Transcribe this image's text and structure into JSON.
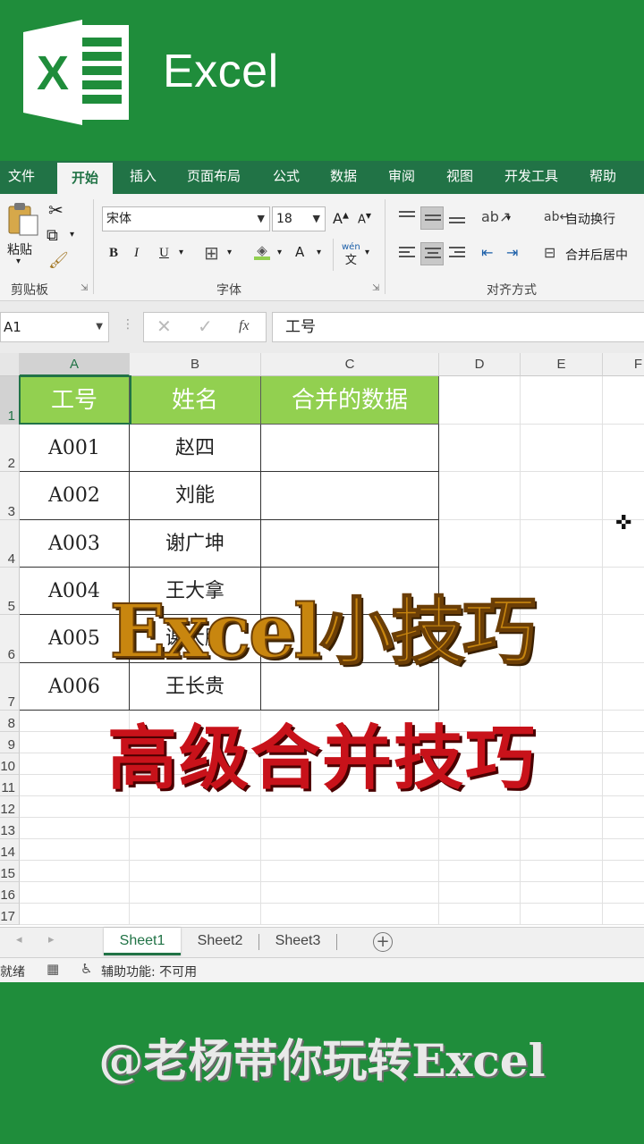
{
  "app": {
    "title": "Excel",
    "logo_letter": "X"
  },
  "ribbon_tabs": [
    "文件",
    "开始",
    "插入",
    "页面布局",
    "公式",
    "数据",
    "审阅",
    "视图",
    "开发工具",
    "帮助"
  ],
  "active_tab": "开始",
  "ribbon": {
    "clipboard": {
      "paste_label": "粘贴",
      "group_label": "剪贴板"
    },
    "font": {
      "font_name": "宋体",
      "font_size": "18",
      "bold": "B",
      "italic": "I",
      "underline": "U",
      "grow": "A",
      "shrink": "A",
      "font_color": "A",
      "phonetic": "wén",
      "group_label": "字体"
    },
    "alignment": {
      "wrap_label": "自动换行",
      "merge_label": "合并后居中",
      "group_label": "对齐方式"
    }
  },
  "formula_bar": {
    "name_box": "A1",
    "fx": "fx",
    "value": "工号"
  },
  "columns": [
    "A",
    "B",
    "C",
    "D",
    "E",
    "F"
  ],
  "rows": [
    "1",
    "2",
    "3",
    "4",
    "5",
    "6",
    "7",
    "8",
    "9",
    "10",
    "11",
    "12",
    "13",
    "14",
    "15",
    "16",
    "17"
  ],
  "table": {
    "headers": [
      "工号",
      "姓名",
      "合并的数据"
    ],
    "rows": [
      [
        "A001",
        "赵四",
        ""
      ],
      [
        "A002",
        "刘能",
        ""
      ],
      [
        "A003",
        "谢广坤",
        ""
      ],
      [
        "A004",
        "王大拿",
        ""
      ],
      [
        "A005",
        "谢大脚",
        ""
      ],
      [
        "A006",
        "王长贵",
        ""
      ]
    ]
  },
  "overlay": {
    "line1": "Excel小技巧",
    "line2": "高级合并技巧"
  },
  "sheet_tabs": [
    "Sheet1",
    "Sheet2",
    "Sheet3"
  ],
  "active_sheet": "Sheet1",
  "status": {
    "ready": "就绪",
    "accessibility": "辅助功能: 不可用"
  },
  "footer": {
    "text": "@老杨带你玩转Excel"
  },
  "colors": {
    "excel_green": "#217346",
    "banner_green": "#1f8d3b",
    "header_fill": "#92d050",
    "overlay1": "#c8860f",
    "overlay2": "#c8121a"
  }
}
